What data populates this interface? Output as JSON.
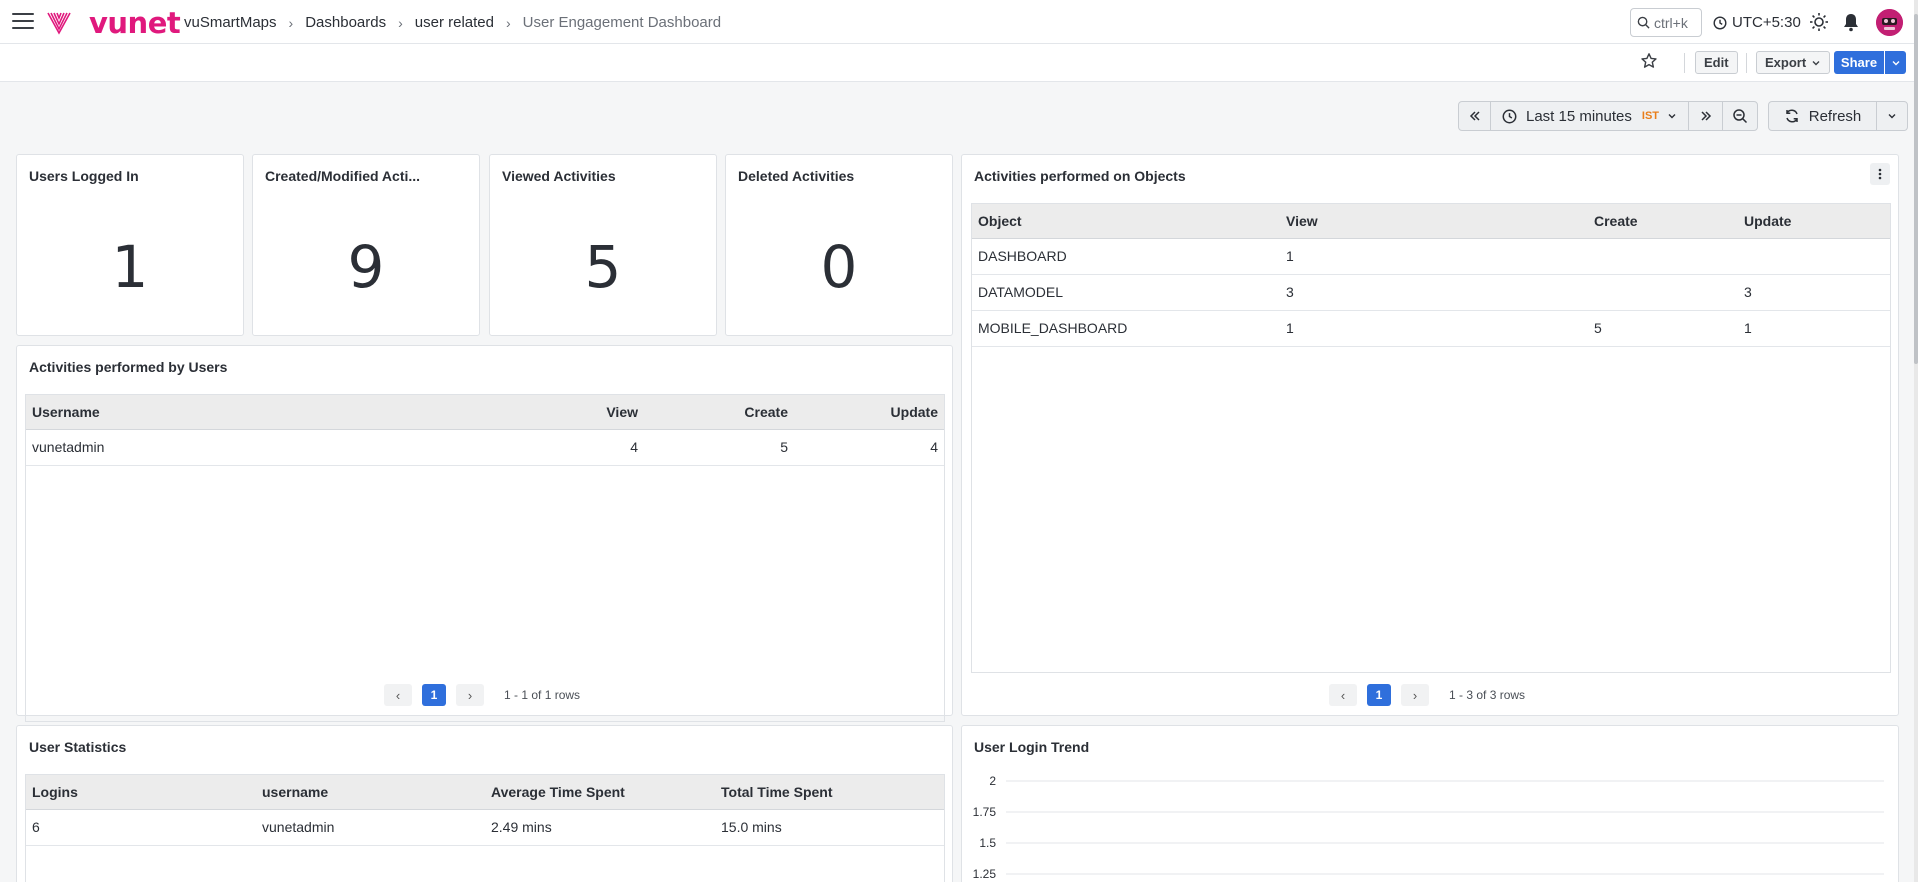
{
  "header": {
    "logo_text": "vunet",
    "breadcrumb": [
      "vuSmartMaps",
      "Dashboards",
      "user related",
      "User Engagement Dashboard"
    ],
    "breadcrumb_separator": "›",
    "search_placeholder": "ctrl+k",
    "timezone": "UTC+5:30",
    "icons": [
      "hamburger-icon",
      "search-icon",
      "clock-icon",
      "sun-icon",
      "bell-icon",
      "avatar"
    ]
  },
  "toolbar": {
    "edit_label": "Edit",
    "export_label": "Export",
    "share_label": "Share"
  },
  "timebar": {
    "range_label": "Last 15 minutes",
    "tz_badge": "IST",
    "refresh_label": "Refresh"
  },
  "stats": [
    {
      "title": "Users Logged In",
      "value": "1"
    },
    {
      "title": "Created/Modified Acti...",
      "value": "9"
    },
    {
      "title": "Viewed Activities",
      "value": "5"
    },
    {
      "title": "Deleted Activities",
      "value": "0"
    }
  ],
  "objects_panel": {
    "title": "Activities performed on Objects",
    "columns": [
      "Object",
      "View",
      "Create",
      "Update"
    ],
    "rows": [
      [
        "DASHBOARD",
        "1",
        "",
        ""
      ],
      [
        "DATAMODEL",
        "3",
        "",
        "3"
      ],
      [
        "MOBILE_DASHBOARD",
        "1",
        "5",
        "1"
      ]
    ],
    "page": "1",
    "summary": "1 - 3 of 3 rows"
  },
  "users_panel": {
    "title": "Activities performed by Users",
    "columns": [
      "Username",
      "View",
      "Create",
      "Update"
    ],
    "rows": [
      [
        "vunetadmin",
        "4",
        "5",
        "4"
      ]
    ],
    "page": "1",
    "summary": "1 - 1 of 1 rows"
  },
  "user_stats_panel": {
    "title": "User Statistics",
    "columns": [
      "Logins",
      "username",
      "Average Time Spent",
      "Total Time Spent"
    ],
    "rows": [
      [
        "6",
        "vunetadmin",
        "2.49 mins",
        "15.0 mins"
      ]
    ]
  },
  "login_trend_panel": {
    "title": "User Login Trend",
    "y_ticks": [
      "2",
      "1.75",
      "1.5",
      "1.25"
    ]
  },
  "colors": {
    "brand": "#e0197d",
    "primary": "#2f6fdc",
    "tz_badge": "#e97e1a"
  }
}
